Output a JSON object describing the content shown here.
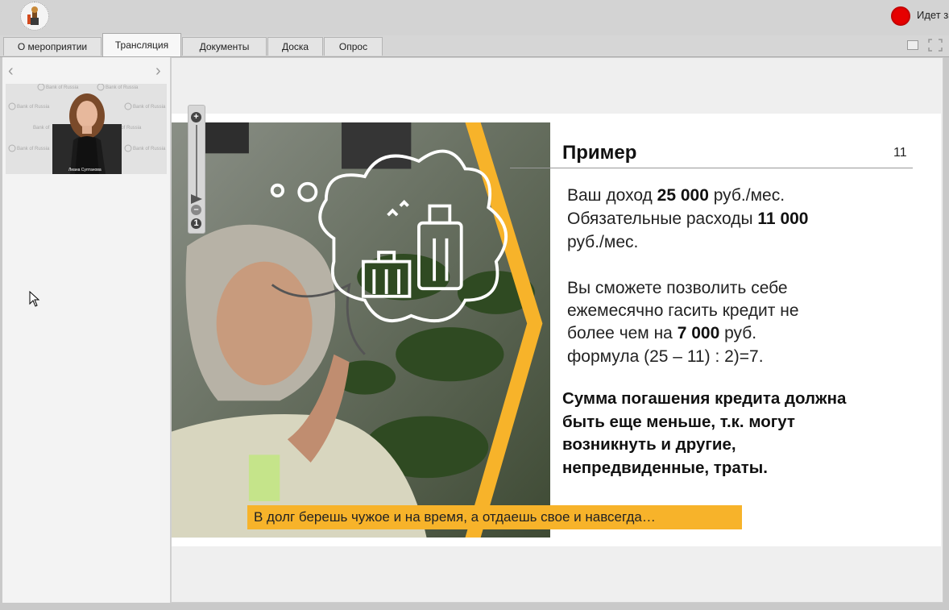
{
  "header": {
    "logo_icon": "conference-logo-icon",
    "recording_status": "Идет за"
  },
  "tabs": [
    {
      "label": "О мероприятии",
      "active": false
    },
    {
      "label": "Трансляция",
      "active": true
    },
    {
      "label": "Документы",
      "active": false
    },
    {
      "label": "Доска",
      "active": false
    },
    {
      "label": "Опрос",
      "active": false
    }
  ],
  "window_controls": {
    "restore_icon": "window-restore-icon",
    "fullscreen_icon": "fullscreen-icon"
  },
  "sidebar": {
    "prev_icon": "chevron-left-icon",
    "next_icon": "chevron-right-icon",
    "video": {
      "watermark": "Bank of Russia",
      "presenter_caption": "Лиана Султанова"
    }
  },
  "zoom": {
    "zoom_in": "+",
    "zoom_out": "–",
    "reset": "1"
  },
  "slide": {
    "title": "Пример",
    "number": "11",
    "p1_a": "Ваш доход ",
    "p1_b": "25 000",
    "p1_c": " руб./мес.",
    "p2_a": "Обязательные расходы ",
    "p2_b": "11 000",
    "p3": "руб./мес.",
    "p4": "Вы сможете позволить себе",
    "p5": "ежемесячно гасить кредит не",
    "p6_a": "более чем на ",
    "p6_b": "7 000",
    "p6_c": " руб.",
    "p7": "формула (25 – 11) : 2)=7.",
    "bold_1": "Сумма погашения кредита должна",
    "bold_2": "быть еще меньше, т.к. могут",
    "bold_3": "возникнуть и другие,",
    "bold_4": "непредвиденные, траты.",
    "caption": "В долг берешь чужое и на время, а отдаешь свое и навсегда…",
    "accent_color": "#f7b32a"
  }
}
